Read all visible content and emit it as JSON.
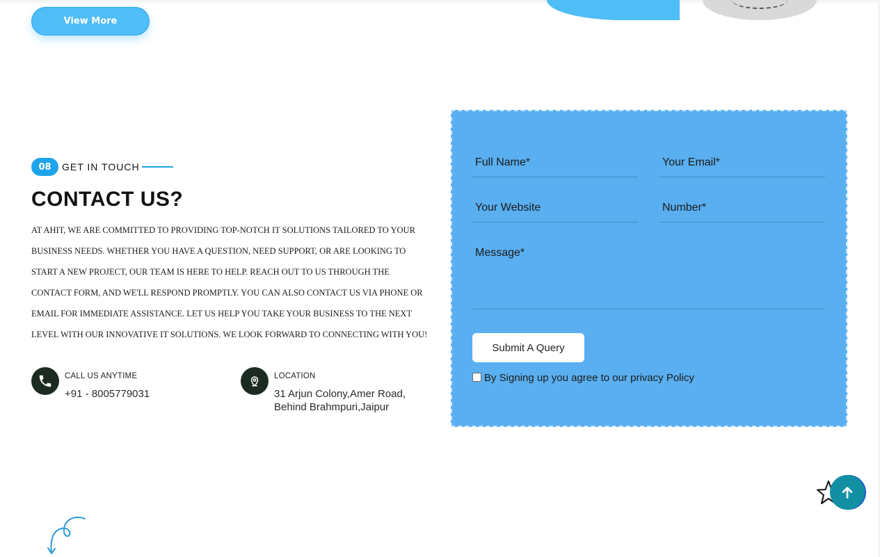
{
  "hero": {
    "view_more_label": "View More"
  },
  "contact": {
    "badge": "08",
    "eyebrow": "GET IN TOUCH",
    "title": "CONTACT US?",
    "description": "AT AHIT, WE ARE COMMITTED TO PROVIDING TOP-NOTCH IT SOLUTIONS TAILORED TO YOUR BUSINESS NEEDS. WHETHER YOU HAVE A QUESTION, NEED SUPPORT, OR ARE LOOKING TO START A NEW PROJECT, OUR TEAM IS HERE TO HELP. REACH OUT TO US THROUGH THE CONTACT FORM, AND WE'LL RESPOND PROMPTLY. YOU CAN ALSO CONTACT US VIA PHONE OR EMAIL FOR IMMEDIATE ASSISTANCE. LET US HELP YOU TAKE YOUR BUSINESS TO THE NEXT LEVEL WITH OUR INNOVATIVE IT SOLUTIONS. WE LOOK FORWARD TO CONNECTING WITH YOU!",
    "phone": {
      "label": "CALL US ANYTIME",
      "value": "+91 - 8005779031",
      "icon": "phone-icon"
    },
    "location": {
      "label": "LOCATION",
      "line1": "31 Arjun Colony,Amer Road,",
      "line2": "Behind Brahmpuri,Jaipur",
      "icon": "map-pin-icon"
    }
  },
  "form": {
    "full_name_placeholder": "Full Name*",
    "email_placeholder": "Your Email*",
    "website_placeholder": "Your Website",
    "number_placeholder": "Number*",
    "message_placeholder": "Message*",
    "submit_label": "Submit A Query",
    "consent_text": "By Signing up you agree to our privacy Policy",
    "background_color": "#5aaff0"
  },
  "colors": {
    "accent": "#1ea4ea",
    "button": "#4fbdf6",
    "scroll_top": "#138fa3"
  }
}
